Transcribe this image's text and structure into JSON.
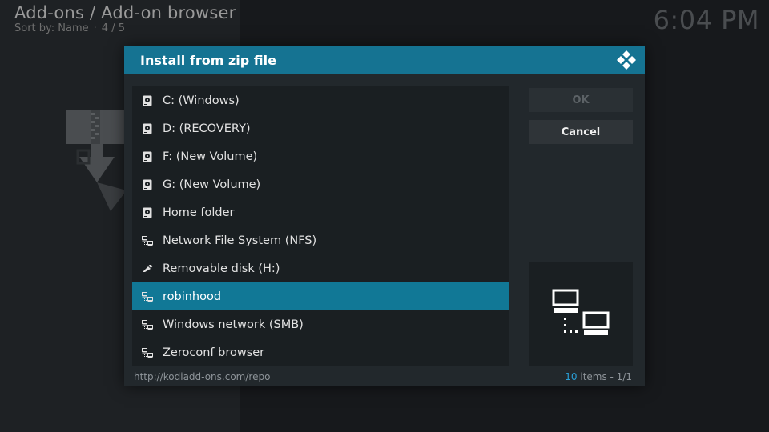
{
  "header": {
    "title": "Add-ons / Add-on browser",
    "sort_label": "Sort by: Name",
    "separator": "·",
    "position": "4 / 5",
    "clock": "6:04 PM"
  },
  "dialog": {
    "title": "Install from zip file",
    "items": [
      {
        "label": "C: (Windows)",
        "icon": "hard-drive-icon"
      },
      {
        "label": "D: (RECOVERY)",
        "icon": "hard-drive-icon"
      },
      {
        "label": "F: (New Volume)",
        "icon": "hard-drive-icon"
      },
      {
        "label": "G: (New Volume)",
        "icon": "hard-drive-icon"
      },
      {
        "label": "Home folder",
        "icon": "hard-drive-icon"
      },
      {
        "label": "Network File System (NFS)",
        "icon": "network-icon"
      },
      {
        "label": "Removable disk (H:)",
        "icon": "usb-icon"
      },
      {
        "label": "robinhood",
        "icon": "network-icon",
        "selected": true
      },
      {
        "label": "Windows network (SMB)",
        "icon": "network-icon"
      },
      {
        "label": "Zeroconf browser",
        "icon": "network-icon"
      }
    ],
    "ok_label": "OK",
    "cancel_label": "Cancel",
    "path": "http://kodiadd-ons.com/repo",
    "count_num": "10",
    "count_suffix": " items - 1/1"
  },
  "colors": {
    "accent": "#157392",
    "selected": "#117896",
    "count_highlight": "#2a9fd6"
  }
}
